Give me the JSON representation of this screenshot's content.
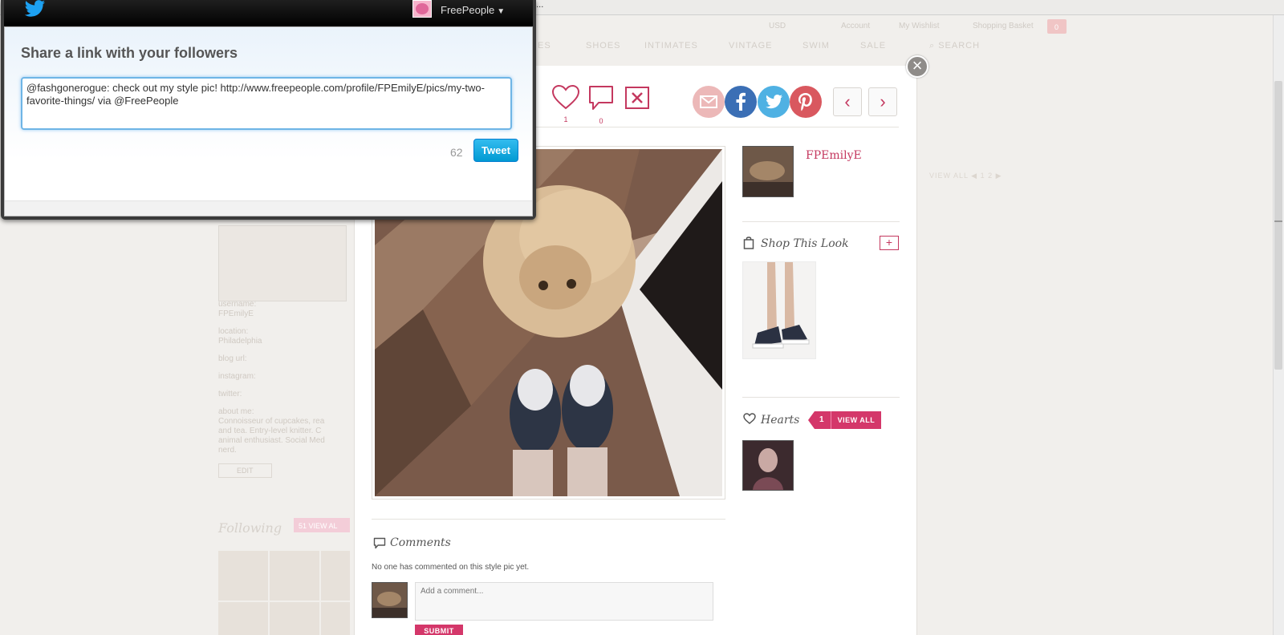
{
  "browser": {
    "title_fragment": "o..."
  },
  "background_page": {
    "utility_links": [
      "USD",
      "Account",
      "My Wishlist",
      "Shopping Basket"
    ],
    "bag_count": "0",
    "categories": [
      "ES",
      "SHOES",
      "INTIMATES",
      "VINTAGE",
      "SWIM",
      "SALE"
    ],
    "search_label": "SEARCH",
    "profile_info": [
      "username:",
      "FPEmilyE",
      "location:",
      "Philadelphia",
      "blog url:",
      "instagram:",
      "twitter:",
      "about me:",
      "Connoisseur of cupcakes, rea",
      "and tea. Entry-level knitter. C",
      "animal enthusiast. Social Med",
      "nerd."
    ],
    "edit_label": "EDIT",
    "following_label": "Following",
    "following_ribbon": "51  VIEW AL",
    "viewall_right": "VIEW ALL  ◀ 1 2 ▶"
  },
  "modal": {
    "title_fragment": "s",
    "heart_count": "1",
    "comment_count": "0",
    "owner_name": "FPEmilyE",
    "shop_title": "Shop This Look",
    "shop_plus": "+",
    "hearts_title": "Hearts",
    "hearts_count": "1",
    "hearts_view_all": "VIEW ALL",
    "comments_title": "Comments",
    "no_comments": "No one has commented on this style pic yet.",
    "comment_placeholder": "Add a comment...",
    "submit_label": "SUBMIT",
    "close_glyph": "×",
    "prev_glyph": "‹",
    "next_glyph": "›"
  },
  "twitter": {
    "username": "FreePeople",
    "heading": "Share a link with your followers",
    "tweet_text": "@fashgonerogue: check out my style pic! http://www.freepeople.com/profile/FPEmilyE/pics/my-two-favorite-things/ via @FreePeople",
    "char_count": "62",
    "tweet_button": "Tweet"
  },
  "colors": {
    "accent_pink": "#d4376a",
    "twitter_blue": "#1da1f2",
    "facebook_blue": "#3b5998",
    "twitter_light": "#55acee",
    "pinterest_red": "#cb2027"
  },
  "icons": [
    "twitter-bird-icon",
    "heart-icon",
    "comment-icon",
    "x-icon",
    "email-icon",
    "facebook-icon",
    "twitter-icon",
    "pinterest-icon",
    "shopping-bag-icon",
    "comment-bubble-icon"
  ]
}
